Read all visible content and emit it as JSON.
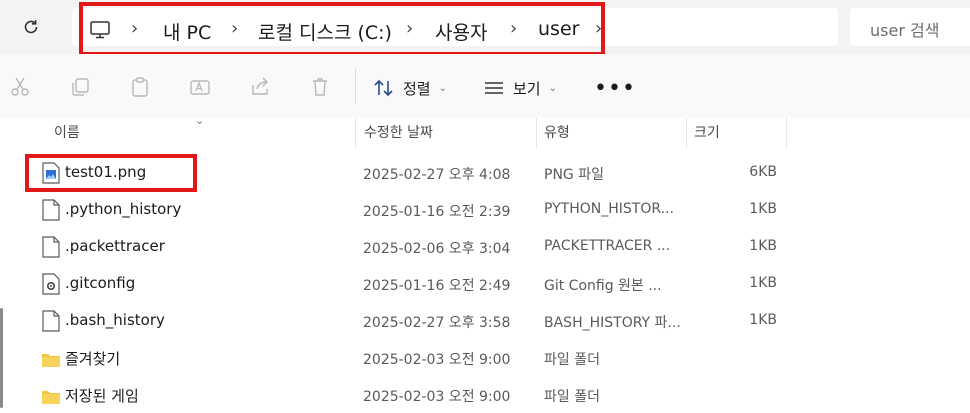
{
  "address_bar": {
    "breadcrumbs": [
      "내 PC",
      "로컬 디스크 (C:)",
      "사용자",
      "user"
    ],
    "separator": "›",
    "search_placeholder": "user 검색"
  },
  "toolbar": {
    "icons": [
      "cut-icon",
      "copy-icon",
      "paste-icon",
      "rename-icon",
      "share-icon",
      "delete-icon"
    ],
    "sort_label": "정렬",
    "view_label": "보기",
    "more_label": "•••"
  },
  "columns": {
    "name": "이름",
    "date": "수정한 날짜",
    "type": "유형",
    "size": "크기"
  },
  "files": [
    {
      "name": "test01.png",
      "date": "2025-02-27 오후 4:08",
      "type": "PNG 파일",
      "size": "6KB",
      "icon": "png-file-icon"
    },
    {
      "name": ".python_history",
      "date": "2025-01-16 오전 2:39",
      "type": "PYTHON_HISTOR...",
      "size": "1KB",
      "icon": "file-icon"
    },
    {
      "name": ".packettracer",
      "date": "2025-02-06 오후 3:04",
      "type": "PACKETTRACER ...",
      "size": "1KB",
      "icon": "file-icon"
    },
    {
      "name": ".gitconfig",
      "date": "2025-01-16 오전 2:49",
      "type": "Git Config 원본 ...",
      "size": "1KB",
      "icon": "config-file-icon"
    },
    {
      "name": ".bash_history",
      "date": "2025-02-27 오후 3:58",
      "type": "BASH_HISTORY 파...",
      "size": "1KB",
      "icon": "file-icon"
    },
    {
      "name": "즐겨찾기",
      "date": "2025-02-03 오전 9:00",
      "type": "파일 폴더",
      "size": "",
      "icon": "folder-icon"
    },
    {
      "name": "저장된 게임",
      "date": "2025-02-03 오전 9:00",
      "type": "파일 폴더",
      "size": "",
      "icon": "folder-icon"
    }
  ],
  "colors": {
    "highlight": "#e01818",
    "folder": "#f4c542",
    "png_icon": "#2f6fd6"
  }
}
